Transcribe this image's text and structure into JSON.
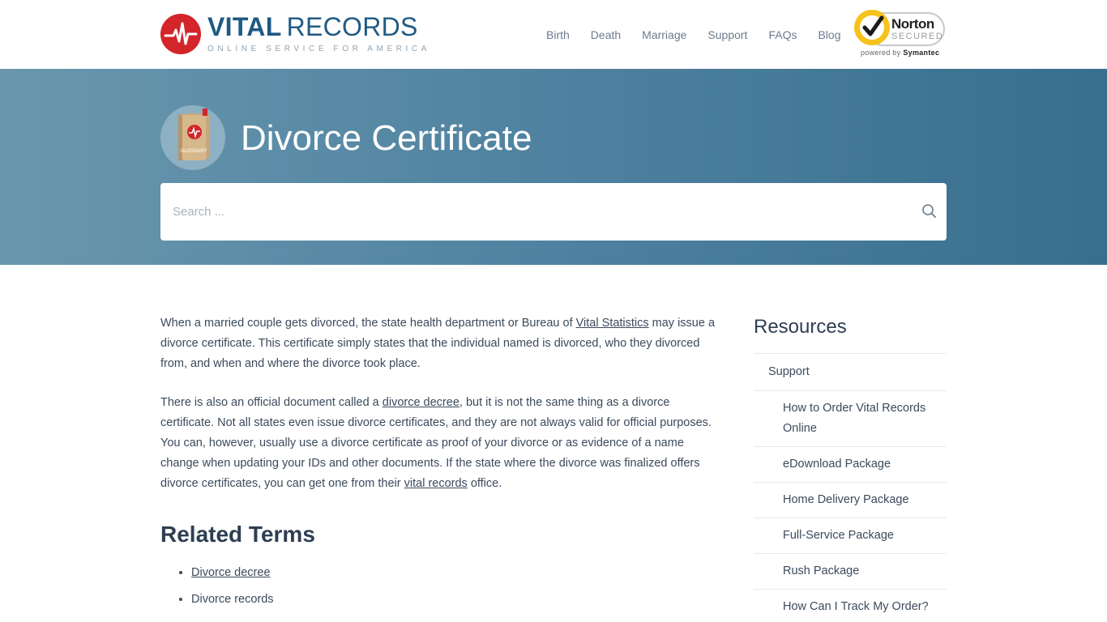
{
  "brand": {
    "name_bold": "VITAL",
    "name_light": "RECORDS",
    "tagline": "ONLINE SERVICE FOR AMERICA"
  },
  "nav": [
    {
      "label": "Birth"
    },
    {
      "label": "Death"
    },
    {
      "label": "Marriage"
    },
    {
      "label": "Support"
    },
    {
      "label": "FAQs"
    },
    {
      "label": "Blog"
    }
  ],
  "norton": {
    "name": "Norton",
    "secured": "SECURED",
    "powered_prefix": "powered by",
    "powered_brand": "Symantec"
  },
  "hero": {
    "icon_label": "GLOSSARY",
    "title": "Divorce Certificate",
    "search_placeholder": "Search ..."
  },
  "article": {
    "p1_a": "When a married couple gets divorced, the state health department or Bureau of ",
    "p1_link": "Vital Statistics",
    "p1_b": " may issue a divorce certificate. This certificate simply states that the individual named is divorced, who they divorced from, and when and where the divorce took place.",
    "p2_a": "There is also an official document called a ",
    "p2_link1": "divorce decree",
    "p2_b": ", but it is not the same thing as a divorce certificate. Not all states even issue divorce certificates, and they are not always valid for official purposes. You can, however, usually use a divorce certificate as proof of your divorce or as evidence of a name change when updating your IDs and other documents. If the state where the divorce was finalized offers divorce certificates, you can get one from their ",
    "p2_link2": "vital records",
    "p2_c": " office.",
    "related_heading": "Related Terms",
    "related": [
      {
        "label": "Divorce decree",
        "link": true
      },
      {
        "label": "Divorce records",
        "link": false
      }
    ]
  },
  "sidebar": {
    "heading": "Resources",
    "top": "Support",
    "items": [
      {
        "label": "How to Order Vital Records Online"
      },
      {
        "label": "eDownload Package"
      },
      {
        "label": "Home Delivery Package"
      },
      {
        "label": "Full-Service Package"
      },
      {
        "label": "Rush Package"
      },
      {
        "label": "How Can I Track My Order?"
      }
    ]
  },
  "colors": {
    "brand_red": "#d3252a",
    "brand_blue": "#1f5a83",
    "hero_start": "#6a97ae",
    "hero_end": "#3a6e8e",
    "norton_yellow": "#f6c21c"
  },
  "icons": [
    "heartbeat-icon",
    "norton-check-icon",
    "glossary-book-icon",
    "search-icon"
  ]
}
